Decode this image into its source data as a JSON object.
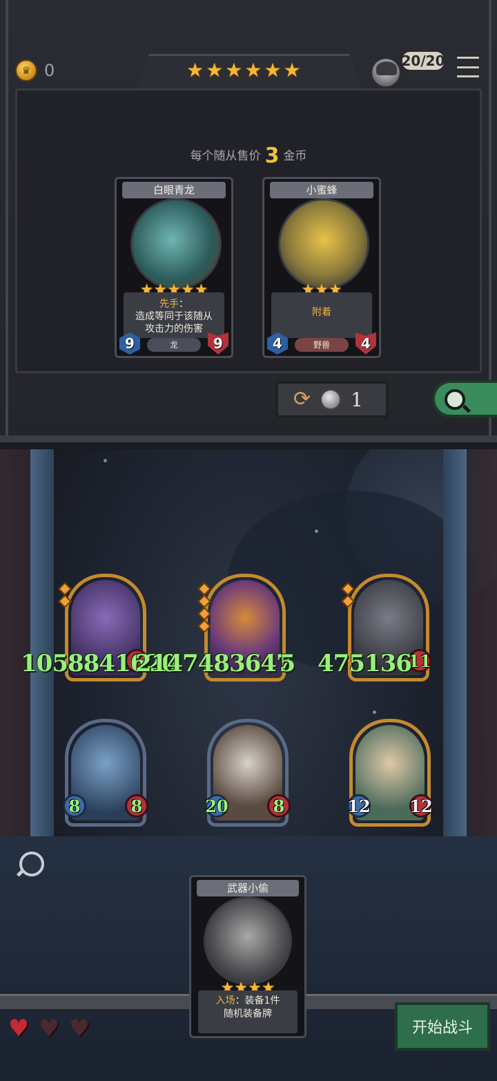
{
  "header": {
    "gold": "0",
    "tier_stars": 6,
    "health": "20/20"
  },
  "shop": {
    "sell_prefix": "每个随从售价",
    "sell_price": "3",
    "sell_suffix": "金币",
    "cards": [
      {
        "name": "白眼青龙",
        "stars": 5,
        "keyword": "先手",
        "keyword_sep": "：",
        "text_line1": "造成等同于该随从",
        "text_line2": "攻击力的伤害",
        "tribe": "龙",
        "attack": "9",
        "health": "9",
        "tribe_color": "#4a4d5a",
        "art_color": "#3e8a8a"
      },
      {
        "name": "小蜜蜂",
        "stars": 3,
        "keyword": "附着",
        "tribe": "野兽",
        "attack": "4",
        "health": "4",
        "tribe_color": "#7a4444",
        "art_color": "#c9a13a"
      }
    ],
    "reroll_cost": "1"
  },
  "board": {
    "minions": [
      {
        "attack": "1058841620",
        "health": "",
        "frame": "gold",
        "gems": 2,
        "art": "#5a4a8a"
      },
      {
        "attack": "2147483647",
        "health": "5",
        "frame": "gold",
        "gems": 4,
        "art": "#7a4a8a"
      },
      {
        "attack": "475136",
        "health": "11",
        "frame": "gold",
        "gems": 2,
        "art": "#4a4c55"
      },
      {
        "attack": "8",
        "health": "8",
        "frame": "silver",
        "gems": 0,
        "art": "#3a5a7a"
      },
      {
        "attack": "20",
        "health": "8",
        "frame": "silver",
        "gems": 0,
        "art": "#5a4a40"
      },
      {
        "attack": "12",
        "health": "12",
        "frame": "gold",
        "gems": 0,
        "art": "#6a8a6a"
      }
    ]
  },
  "hand": {
    "card": {
      "name": "武器小偷",
      "stars": 4,
      "keyword": "入场",
      "keyword_sep": "：",
      "text_line1": "装备1件",
      "text_line2": "随机装备牌"
    }
  },
  "lives": {
    "filled": 1,
    "total": 3
  },
  "actions": {
    "start_battle": "开始战斗"
  },
  "colors": {
    "accent_gold": "#f4b63a",
    "stat_green": "#9af07a",
    "start_green": "#2f6e4a"
  }
}
